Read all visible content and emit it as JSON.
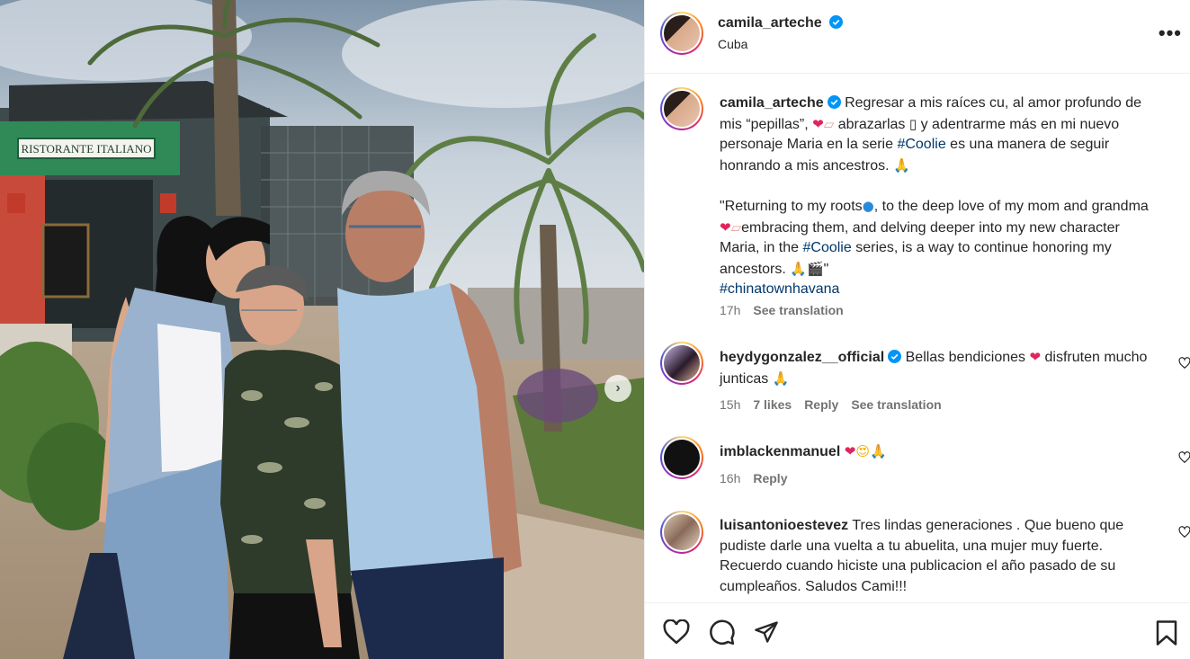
{
  "post": {
    "username": "camila_arteche",
    "location": "Cuba"
  },
  "photo": {
    "sign_text": "RISTORANTE ITALIANO"
  },
  "caption": {
    "username": "camila_arteche",
    "text_part1": "Regresar a mis raíces cu, al amor profundo de mis “pepillas”,",
    "text_part2": "abrazarlas",
    "text_part3": "y adentrarme más en mi nuevo personaje Maria en la serie",
    "hashtag1": "#Coolie",
    "text_part4": "es una manera de seguir honrando a mis ancestros.",
    "en_part1": "\"Returning to my roots",
    "en_part2": ", to the deep love of my mom and grandma",
    "en_part3": "embracing them, and delving deeper into my new character Maria, in the",
    "hashtag2": "#Coolie",
    "en_part4": "series, is a way to continue honoring my ancestors.",
    "en_part5": "\"",
    "hashtag3": "#chinatownhavana",
    "time": "17h",
    "see_translation": "See translation"
  },
  "comments": [
    {
      "username": "heydygonzalez__official",
      "text_a": "Bellas bendiciones",
      "text_b": "disfruten mucho junticas",
      "time": "15h",
      "likes": "7 likes",
      "reply": "Reply",
      "see_translation": "See translation"
    },
    {
      "username": "imblackenmanuel",
      "time": "16h",
      "reply": "Reply"
    },
    {
      "username": "luisantonioestevez",
      "text": "Tres lindas generaciones . Que bueno que pudiste darle una vuelta a tu abuelita, una mujer muy fuerte. Recuerdo cuando hiciste una publicacion el año pasado de su cumpleaños. Saludos Cami!!!"
    }
  ],
  "colors": {
    "verified": "#0095f6",
    "hashtag": "#00376b",
    "heart_emoji": "#e0245e"
  }
}
